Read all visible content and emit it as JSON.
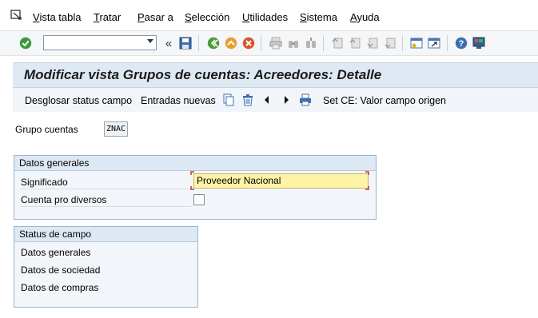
{
  "menu": {
    "items": [
      {
        "id": "vista",
        "first": "V",
        "rest": "ista tabla"
      },
      {
        "id": "tratar",
        "first": "T",
        "rest": "ratar"
      },
      {
        "id": "pasar",
        "first": "P",
        "rest": "asar a"
      },
      {
        "id": "seleccion",
        "first": "S",
        "rest": "elección"
      },
      {
        "id": "utilidades",
        "first": "U",
        "rest": "tilidades"
      },
      {
        "id": "sistema",
        "first": "S",
        "rest": "istema"
      },
      {
        "id": "ayuda",
        "first": "A",
        "rest": "yuda"
      }
    ]
  },
  "toolbar": {
    "command_value": "",
    "icons": [
      "enter-icon",
      "back-arrows-icon",
      "save-icon",
      "back-icon",
      "exit-icon",
      "cancel-icon",
      "print-icon",
      "find-icon",
      "find-next-icon",
      "first-page-icon",
      "previous-page-icon",
      "next-page-icon",
      "last-page-icon",
      "create-session-icon",
      "shortcut-icon",
      "help-icon",
      "customize-layout-icon"
    ]
  },
  "title": "Modificar vista Grupos de cuentas: Acreedores: Detalle",
  "app_toolbar": {
    "desglosar": "Desglosar status campo",
    "entradas": "Entradas nuevas",
    "setce": "Set CE: Valor campo origen"
  },
  "header_field": {
    "label": "Grupo cuentas",
    "value": "ZNAC"
  },
  "datos_generales": {
    "title": "Datos generales",
    "significado_label": "Significado",
    "significado_value": "Proveedor Nacional",
    "cuenta_label": "Cuenta pro diversos",
    "cuenta_checked": false
  },
  "status_campo": {
    "title": "Status de campo",
    "items": [
      "Datos generales",
      "Datos de sociedad",
      "Datos de compras"
    ]
  },
  "colors": {
    "accent": "#dfe9f3",
    "input_highlight": "#fff4a6",
    "group_border": "#9db4cc"
  }
}
